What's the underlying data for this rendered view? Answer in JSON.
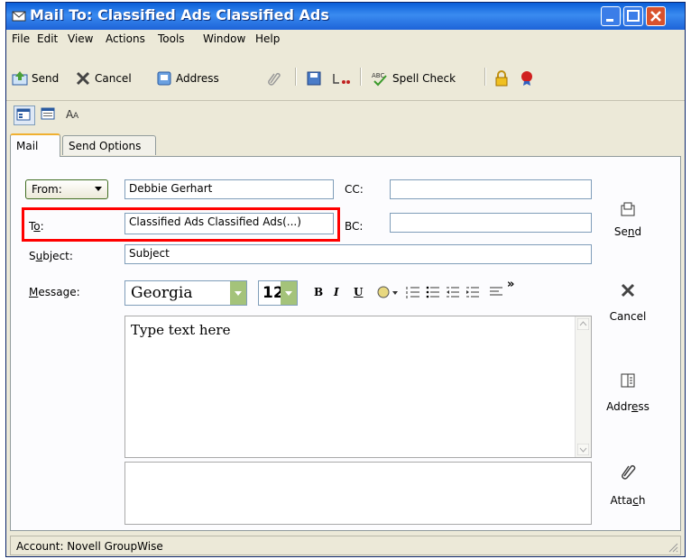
{
  "window": {
    "title": "Mail To: Classified Ads Classified Ads"
  },
  "menu": [
    "File",
    "Edit",
    "View",
    "Actions",
    "Tools",
    "Window",
    "Help"
  ],
  "toolbar": {
    "send": "Send",
    "cancel": "Cancel",
    "address": "Address",
    "spell_check": "Spell Check"
  },
  "tabs": [
    "Mail",
    "Send Options"
  ],
  "form": {
    "from_label": "From:",
    "from_value": "Debbie Gerhart",
    "to_label": "To:",
    "to_value": "Classified Ads Classified Ads(...)",
    "cc_label": "CC:",
    "cc_value": "",
    "bc_label": "BC:",
    "bc_value": "",
    "subject_label": "Subject:",
    "subject_value": "Subject",
    "message_label": "Message:"
  },
  "format": {
    "font": "Georgia",
    "size": "12"
  },
  "message": {
    "body": "Type text here"
  },
  "side_buttons": {
    "send": "Send",
    "cancel": "Cancel",
    "address": "Address",
    "attach": "Attach"
  },
  "status": {
    "account": "Account: Novell GroupWise"
  },
  "colors": {
    "titlebar": "#1d63d8",
    "highlight": "#ff0000",
    "tab_accent": "#f0b030"
  }
}
